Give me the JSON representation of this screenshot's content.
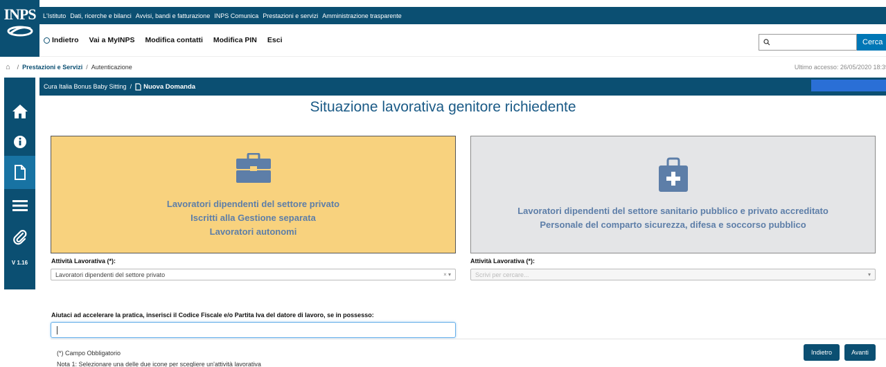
{
  "brand": {
    "logo_text": "INPS"
  },
  "top_nav": [
    "L'Istituto",
    "Dati, ricerche e bilanci",
    "Avvisi, bandi e fatturazione",
    "INPS Comunica",
    "Prestazioni e servizi",
    "Amministrazione trasparente"
  ],
  "user_nav": {
    "back": "Indietro",
    "myinps": "Vai a MyINPS",
    "contacts": "Modifica contatti",
    "pin": "Modifica PIN",
    "exit": "Esci"
  },
  "search": {
    "placeholder": "",
    "button": "Cerca"
  },
  "breadcrumb": {
    "section": "Prestazioni e Servizi",
    "current": "Autenticazione"
  },
  "last_access": "Ultimo accesso: 26/05/2020 18:39",
  "sidebar": {
    "items": [
      "home-icon",
      "info-icon",
      "document-icon",
      "menu-icon",
      "paperclip-icon"
    ],
    "version": "V 1.16"
  },
  "subbar": {
    "service": "Cura Italia Bonus Baby Sitting",
    "page": "Nuova Domanda"
  },
  "main": {
    "title": "Situazione lavorativa genitore richiedente",
    "card_private": {
      "lines": [
        "Lavoratori dipendenti del settore privato",
        "Iscritti alla Gestione separata",
        "Lavoratori autonomi"
      ]
    },
    "card_health": {
      "lines": [
        "Lavoratori dipendenti del settore sanitario pubblico e privato accreditato",
        "Personale del comparto sicurezza, difesa e soccorso pubblico"
      ]
    },
    "activity_left": {
      "label": "Attività Lavorativa (*):",
      "value": "Lavoratori dipendenti del settore privato"
    },
    "activity_right": {
      "label": "Attività Lavorativa (*):",
      "placeholder": "Scrivi per cercare..."
    },
    "cf_label": "Aiutaci ad accelerare la pratica, inserisci il Codice Fiscale e/o Partita Iva del datore di lavoro, se in possesso:",
    "cf_value": "",
    "required_note": "(*) Campo Obbligatorio",
    "note1": "Nota 1: Selezionare una delle due icone per scegliere un'attività lavorativa",
    "back_button": "Indietro",
    "next_button": "Avanti"
  },
  "colors": {
    "primary": "#0b4f72",
    "card_selected": "#f8d27e",
    "card_other": "#e4e5e7",
    "icon": "#5d7ea8"
  }
}
